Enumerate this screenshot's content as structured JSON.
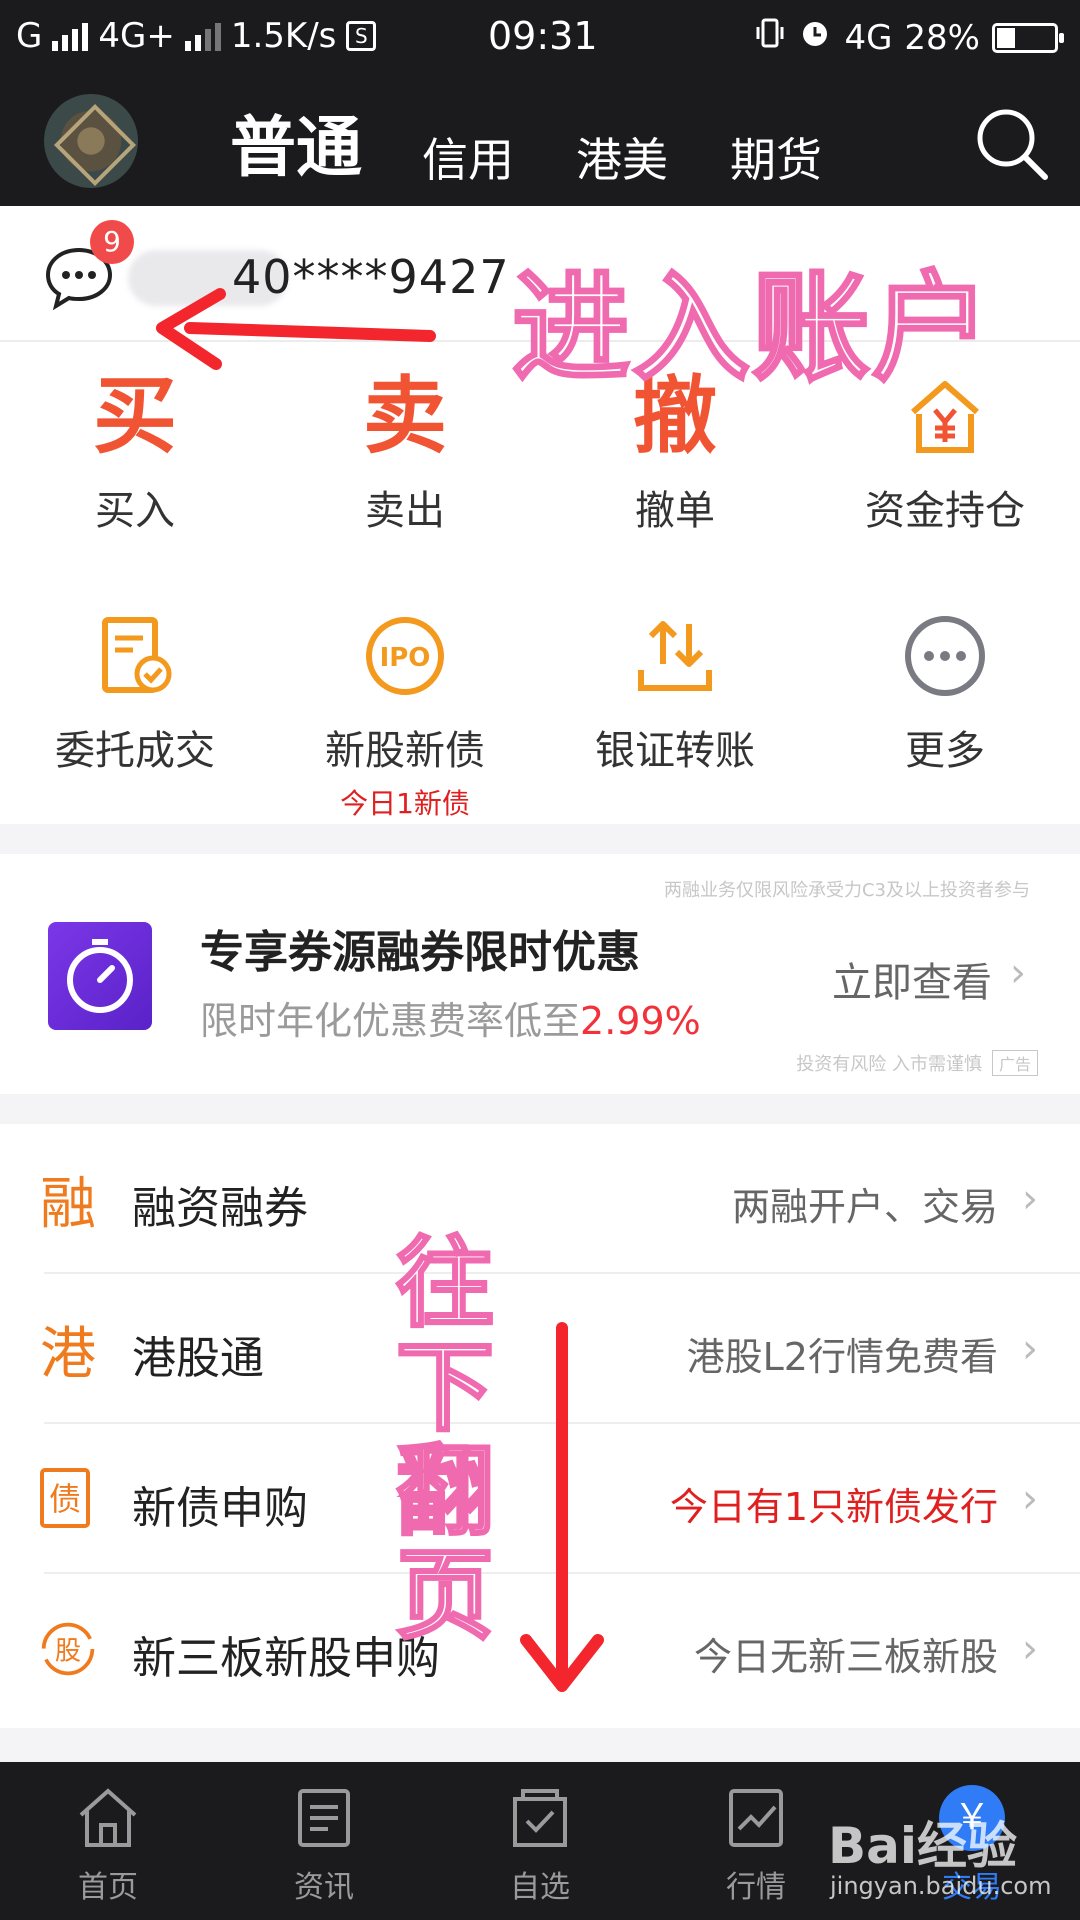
{
  "status_bar": {
    "carrier1": "G",
    "net": "4G+",
    "speed": "1.5K/s",
    "time": "09:31",
    "net2": "4G",
    "battery": "28%"
  },
  "header": {
    "tabs": [
      "普通",
      "信用",
      "港美",
      "期货"
    ],
    "active_tab": "普通"
  },
  "account": {
    "badge_count": "9",
    "number": "40****9427"
  },
  "grid": {
    "items": [
      {
        "icon": "买",
        "label": "买入"
      },
      {
        "icon": "卖",
        "label": "卖出"
      },
      {
        "icon": "撤",
        "label": "撤单"
      },
      {
        "icon": "yuan-house-icon",
        "label": "资金持仓"
      },
      {
        "icon": "document-check-icon",
        "label": "委托成交"
      },
      {
        "icon": "IPO",
        "label": "新股新债",
        "sub": "今日1新债"
      },
      {
        "icon": "transfer-arrows-icon",
        "label": "银证转账"
      },
      {
        "icon": "more-dots-icon",
        "label": "更多"
      }
    ]
  },
  "promo": {
    "note": "两融业务仅限风险承受力C3及以上投资者参与",
    "title": "专享券源融券限时优惠",
    "subtitle_prefix": "限时年化优惠费率低至",
    "rate": "2.99%",
    "link": "立即查看",
    "risk": "投资有风险 入市需谨慎",
    "ad": "广告"
  },
  "list": [
    {
      "icon": "融",
      "title": "融资融券",
      "desc": "两融开户、交易",
      "highlight": false
    },
    {
      "icon": "港",
      "title": "港股通",
      "desc": "港股L2行情免费看",
      "highlight": false
    },
    {
      "icon": "债",
      "title": "新债申购",
      "desc": "今日有1只新债发行",
      "highlight": true
    },
    {
      "icon": "股",
      "title": "新三板新股申购",
      "desc": "今日无新三板新股",
      "highlight": false
    }
  ],
  "bottom_nav": [
    {
      "icon": "home-icon",
      "label": "首页"
    },
    {
      "icon": "news-icon",
      "label": "资讯"
    },
    {
      "icon": "watchlist-icon",
      "label": "自选"
    },
    {
      "icon": "chart-icon",
      "label": "行情"
    },
    {
      "icon": "trade-icon",
      "label": "交易",
      "badge": "￥"
    }
  ],
  "annotations": {
    "enter_account": "进入账户",
    "scroll_down": "往下翻页"
  },
  "watermark": {
    "brand": "Bai经验",
    "url": "jingyan.baidu.com"
  },
  "colors": {
    "header_bg": "#1b1b1d",
    "accent_orange": "#f07b1e",
    "accent_red": "#e02020",
    "active_blue": "#2f7cf6",
    "annotation_pink": "#f06ab0"
  }
}
